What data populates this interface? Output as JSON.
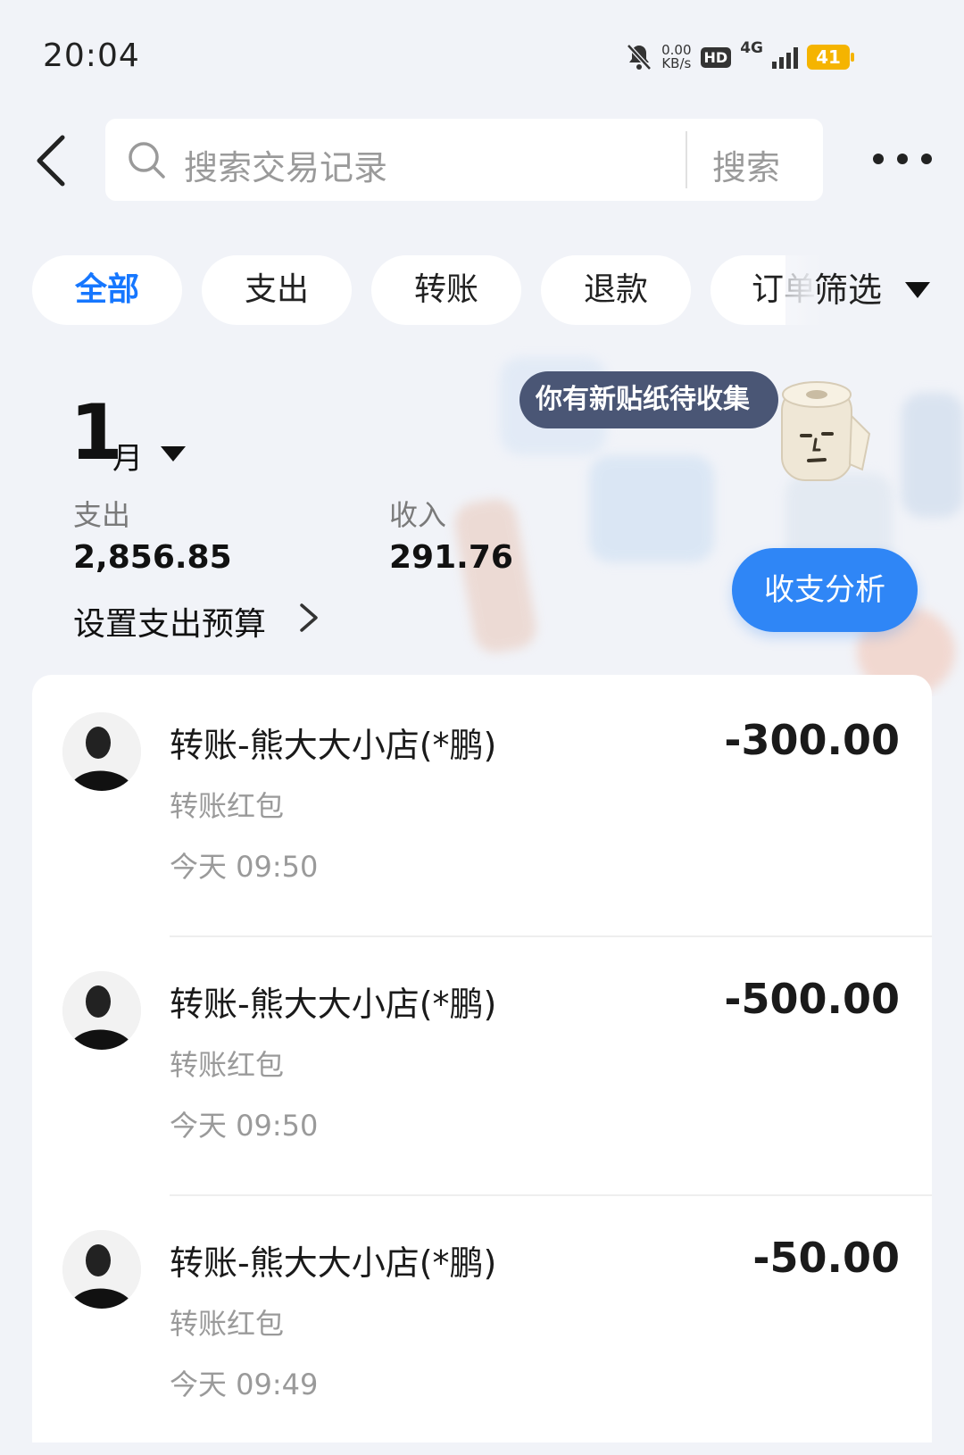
{
  "status_bar": {
    "time": "20:04",
    "net_speed": "0.00",
    "net_unit": "KB/s",
    "hd": "HD",
    "network": "4G",
    "battery": "41",
    "icons": [
      "bell-mute-icon",
      "signal-icon",
      "battery-icon"
    ]
  },
  "search": {
    "placeholder": "搜索交易记录",
    "button": "搜索"
  },
  "tabs": [
    {
      "label": "全部",
      "active": true
    },
    {
      "label": "支出"
    },
    {
      "label": "转账"
    },
    {
      "label": "退款"
    },
    {
      "label": "订单"
    }
  ],
  "filter": {
    "label": "筛选"
  },
  "summary": {
    "month": "1",
    "month_unit": "月",
    "expense_label": "支出",
    "expense_value": "2,856.85",
    "income_label": "收入",
    "income_value": "291.76",
    "budget_link": "设置支出预算",
    "sticker_tip": "你有新贴纸待收集",
    "analysis_button": "收支分析"
  },
  "transactions": [
    {
      "title": "转账-熊大大小店(*鹏)",
      "subtitle": "转账红包",
      "time": "今天 09:50",
      "amount": "-300.00"
    },
    {
      "title": "转账-熊大大小店(*鹏)",
      "subtitle": "转账红包",
      "time": "今天 09:50",
      "amount": "-500.00"
    },
    {
      "title": "转账-熊大大小店(*鹏)",
      "subtitle": "转账红包",
      "time": "今天 09:49",
      "amount": "-50.00"
    }
  ],
  "colors": {
    "accent": "#1677ff",
    "analysis_button": "#2f86f6",
    "background": "#f1f3f8",
    "battery": "#f5b400"
  }
}
